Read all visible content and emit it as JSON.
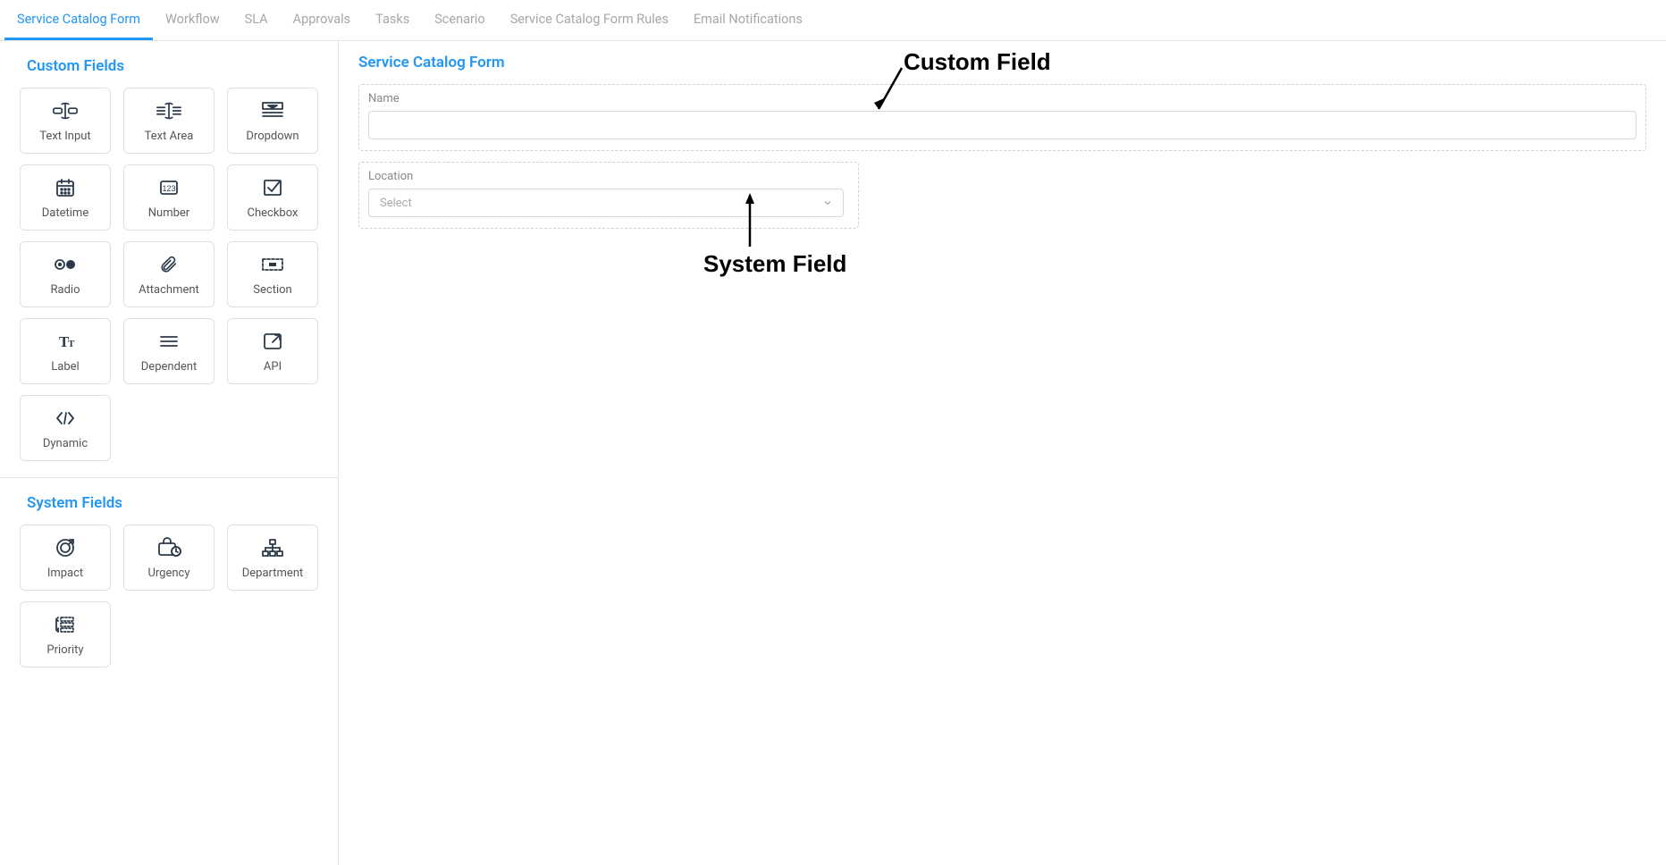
{
  "tabs": [
    {
      "id": "service-catalog-form",
      "label": "Service Catalog Form",
      "active": true
    },
    {
      "id": "workflow",
      "label": "Workflow",
      "active": false
    },
    {
      "id": "sla",
      "label": "SLA",
      "active": false
    },
    {
      "id": "approvals",
      "label": "Approvals",
      "active": false
    },
    {
      "id": "tasks",
      "label": "Tasks",
      "active": false
    },
    {
      "id": "scenario",
      "label": "Scenario",
      "active": false
    },
    {
      "id": "service-catalog-form-rules",
      "label": "Service Catalog Form Rules",
      "active": false
    },
    {
      "id": "email-notifications",
      "label": "Email Notifications",
      "active": false
    }
  ],
  "sidebar": {
    "customTitle": "Custom Fields",
    "systemTitle": "System Fields",
    "customFields": [
      {
        "id": "text-input",
        "label": "Text Input",
        "icon": "text-input-icon"
      },
      {
        "id": "text-area",
        "label": "Text Area",
        "icon": "text-area-icon"
      },
      {
        "id": "dropdown",
        "label": "Dropdown",
        "icon": "dropdown-icon"
      },
      {
        "id": "datetime",
        "label": "Datetime",
        "icon": "datetime-icon"
      },
      {
        "id": "number",
        "label": "Number",
        "icon": "number-icon"
      },
      {
        "id": "checkbox",
        "label": "Checkbox",
        "icon": "checkbox-icon"
      },
      {
        "id": "radio",
        "label": "Radio",
        "icon": "radio-icon"
      },
      {
        "id": "attachment",
        "label": "Attachment",
        "icon": "attachment-icon"
      },
      {
        "id": "section",
        "label": "Section",
        "icon": "section-icon"
      },
      {
        "id": "label",
        "label": "Label",
        "icon": "label-icon"
      },
      {
        "id": "dependent",
        "label": "Dependent",
        "icon": "dependent-icon"
      },
      {
        "id": "api",
        "label": "API",
        "icon": "api-icon"
      },
      {
        "id": "dynamic",
        "label": "Dynamic",
        "icon": "dynamic-icon"
      }
    ],
    "systemFields": [
      {
        "id": "impact",
        "label": "Impact",
        "icon": "impact-icon"
      },
      {
        "id": "urgency",
        "label": "Urgency",
        "icon": "urgency-icon"
      },
      {
        "id": "department",
        "label": "Department",
        "icon": "department-icon"
      },
      {
        "id": "priority",
        "label": "Priority",
        "icon": "priority-icon"
      }
    ]
  },
  "form": {
    "title": "Service Catalog Form",
    "nameField": {
      "label": "Name",
      "value": ""
    },
    "locationField": {
      "label": "Location",
      "placeholder": "Select"
    }
  },
  "annotations": {
    "customField": "Custom Field",
    "systemField": "System Field"
  }
}
